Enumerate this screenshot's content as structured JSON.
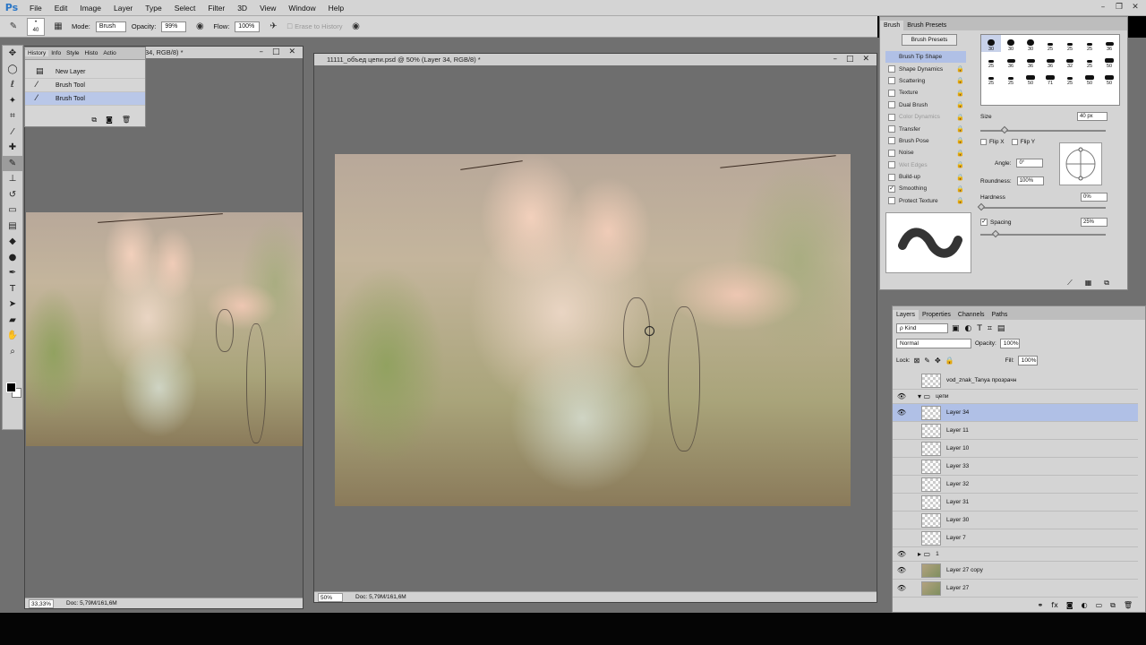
{
  "app": {
    "logo": "Ps"
  },
  "menu": [
    "File",
    "Edit",
    "Image",
    "Layer",
    "Type",
    "Select",
    "Filter",
    "3D",
    "View",
    "Window",
    "Help"
  ],
  "options": {
    "brush_size": "40",
    "mode_label": "Mode:",
    "mode_value": "Brush",
    "opacity_label": "Opacity:",
    "opacity_value": "99%",
    "flow_label": "Flow:",
    "flow_value": "100%",
    "erase_history": "Erase to History"
  },
  "history_panel": {
    "tabs": [
      "History",
      "Info",
      "Style",
      "Histo",
      "Actio"
    ],
    "items": [
      {
        "label": "New Layer",
        "icon": "document-icon"
      },
      {
        "label": "Brush Tool",
        "icon": "brush-icon"
      },
      {
        "label": "Brush Tool",
        "icon": "brush-icon",
        "selected": true
      }
    ]
  },
  "doc_left": {
    "title": "34, RGB/8) *",
    "zoom": "33,33%",
    "doc_info": "Doc: 5,79M/161,6M"
  },
  "doc_main": {
    "title": "11111_объед цепи.psd @ 50% (Layer 34, RGB/8) *",
    "zoom": "50%",
    "doc_info": "Doc: 5,79M/161,6M"
  },
  "brush_panel": {
    "tabs": [
      "Brush",
      "Brush Presets"
    ],
    "presets_button": "Brush Presets",
    "options": [
      {
        "label": "Brush Tip Shape",
        "active": true,
        "checkbox": false
      },
      {
        "label": "Shape Dynamics",
        "checked": false
      },
      {
        "label": "Scattering",
        "checked": false
      },
      {
        "label": "Texture",
        "checked": false
      },
      {
        "label": "Dual Brush",
        "checked": false
      },
      {
        "label": "Color Dynamics",
        "checked": false,
        "dim": true
      },
      {
        "label": "Transfer",
        "checked": false
      },
      {
        "label": "Brush Pose",
        "checked": false
      },
      {
        "label": "Noise",
        "checked": false
      },
      {
        "label": "Wet Edges",
        "checked": false,
        "dim": true
      },
      {
        "label": "Build-up",
        "checked": false
      },
      {
        "label": "Smoothing",
        "checked": true
      },
      {
        "label": "Protect Texture",
        "checked": false
      }
    ],
    "tip_sizes": [
      "30",
      "30",
      "30",
      "25",
      "25",
      "25",
      "36",
      "25",
      "36",
      "36",
      "36",
      "32",
      "25",
      "50",
      "25",
      "25",
      "50",
      "71",
      "25",
      "50",
      "50"
    ],
    "size_label": "Size",
    "size_value": "40 px",
    "flip_x": "Flip X",
    "flip_y": "Flip Y",
    "angle_label": "Angle:",
    "angle_value": "0°",
    "roundness_label": "Roundness:",
    "roundness_value": "100%",
    "hardness_label": "Hardness",
    "hardness_value": "0%",
    "spacing_label": "Spacing",
    "spacing_value": "25%"
  },
  "layers_panel": {
    "tabs": [
      "Layers",
      "Properties",
      "Channels",
      "Paths"
    ],
    "filter": "Kind",
    "blend_mode": "Normal",
    "opacity_label": "Opacity:",
    "opacity_value": "100%",
    "lock_label": "Lock:",
    "fill_label": "Fill:",
    "fill_value": "100%",
    "layers": [
      {
        "name": "vod_znak_Tanya прозрачн",
        "visible": false,
        "kind": "layer"
      },
      {
        "name": "цепи",
        "visible": true,
        "kind": "group-open"
      },
      {
        "name": "Layer 34",
        "visible": true,
        "kind": "layer",
        "selected": true
      },
      {
        "name": "Layer 11",
        "visible": false,
        "kind": "layer"
      },
      {
        "name": "Layer 10",
        "visible": false,
        "kind": "layer"
      },
      {
        "name": "Layer 33",
        "visible": false,
        "kind": "layer"
      },
      {
        "name": "Layer 32",
        "visible": false,
        "kind": "layer"
      },
      {
        "name": "Layer 31",
        "visible": false,
        "kind": "layer"
      },
      {
        "name": "Layer 30",
        "visible": false,
        "kind": "layer"
      },
      {
        "name": "Layer 7",
        "visible": false,
        "kind": "layer"
      },
      {
        "name": "1",
        "visible": true,
        "kind": "group-closed"
      },
      {
        "name": "Layer 27 copy",
        "visible": true,
        "kind": "image"
      },
      {
        "name": "Layer 27",
        "visible": true,
        "kind": "image"
      }
    ]
  }
}
